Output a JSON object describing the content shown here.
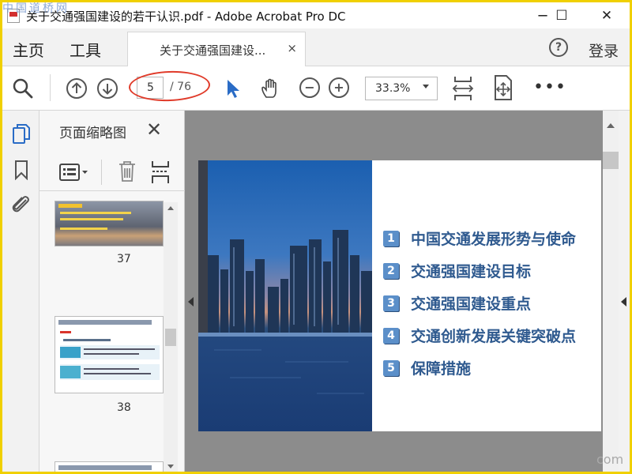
{
  "window": {
    "title": "关于交通强国建设的若干认识.pdf - Adobe Acrobat Pro DC",
    "watermark": "中国道桥网",
    "minimize": "─",
    "maximize": "☐",
    "close": "✕"
  },
  "menu": {
    "home": "主页",
    "tools": "工具",
    "doc_tab": "关于交通强国建设...",
    "doc_tab_close": "×",
    "help": "?",
    "login": "登录"
  },
  "toolbar": {
    "current_page": "5",
    "total_pages": "/ 76",
    "zoom": "33.3%",
    "more": "•••"
  },
  "thumbnails": {
    "title": "页面缩略图",
    "close": "✕",
    "items": [
      {
        "page": "37"
      },
      {
        "page": "38"
      }
    ]
  },
  "document": {
    "toc": [
      {
        "num": "1",
        "text": "中国交通发展形势与使命"
      },
      {
        "num": "2",
        "text": "交通强国建设目标"
      },
      {
        "num": "3",
        "text": "交通强国建设重点"
      },
      {
        "num": "4",
        "text": "交通创新发展关键突破点"
      },
      {
        "num": "5",
        "text": "保障措施"
      }
    ]
  },
  "corner_watermark": "com",
  "colors": {
    "highlight_oval": "#e03b2a",
    "accent_blue": "#2a6cc6",
    "toc_text": "#2f5a8f",
    "toc_badge": "#5b8fc9",
    "frame": "#f0d000"
  }
}
